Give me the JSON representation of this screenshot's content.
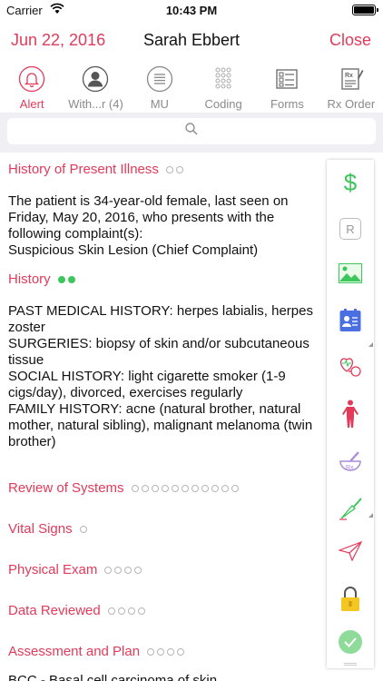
{
  "status": {
    "carrier": "Carrier",
    "time": "10:43 PM"
  },
  "nav": {
    "date": "Jun 22, 2016",
    "title": "Sarah Ebbert",
    "close": "Close"
  },
  "toolbar": [
    {
      "name": "alert",
      "label": "Alert",
      "icon": "bell-icon"
    },
    {
      "name": "with",
      "label": "With...r (4)",
      "icon": "person-icon"
    },
    {
      "name": "mu",
      "label": "MU",
      "icon": "list-icon"
    },
    {
      "name": "coding",
      "label": "Coding",
      "icon": "grid-icon"
    },
    {
      "name": "forms",
      "label": "Forms",
      "icon": "forms-icon"
    },
    {
      "name": "rx-order",
      "label": "Rx Order",
      "icon": "rx-order-icon"
    }
  ],
  "search": {
    "placeholder": ""
  },
  "sections": {
    "hpi": {
      "title": "History of Present Illness",
      "lines": [
        "The patient is 34-year-old female, last seen on Friday, May 20, 2016, who presents with the following complaint(s):",
        "Suspicious Skin Lesion (Chief Complaint)"
      ]
    },
    "history": {
      "title": "History",
      "lines": [
        "PAST MEDICAL HISTORY: herpes labialis, herpes zoster",
        "SURGERIES: biopsy of skin and/or subcutaneous tissue",
        "SOCIAL HISTORY: light cigarette smoker (1-9 cigs/day), divorced, exercises regularly",
        "FAMILY HISTORY: acne (natural brother, natural mother, natural sibling), malignant melanoma (twin brother)"
      ]
    },
    "ros": {
      "title": "Review of Systems"
    },
    "vitals": {
      "title": "Vital Signs"
    },
    "exam": {
      "title": "Physical Exam"
    },
    "data": {
      "title": "Data Reviewed"
    },
    "plan": {
      "title": "Assessment and Plan",
      "first_line": "BCC - Basal cell carcinoma of skin"
    }
  },
  "sidebar": {
    "billing_symbol": "$",
    "r_label": "R",
    "rx_label": "Rx"
  },
  "colors": {
    "accent": "#e33a5a",
    "green": "#3cc65c",
    "gray": "#8a8a8a",
    "blue": "#4a6fe3"
  }
}
